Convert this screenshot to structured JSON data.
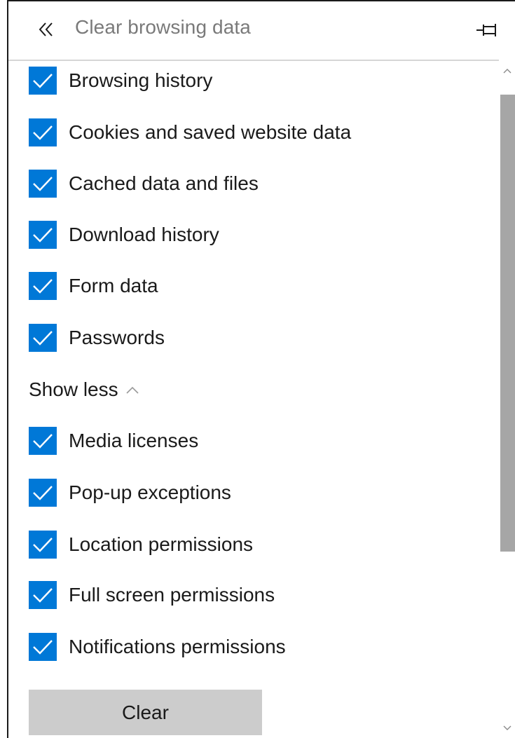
{
  "header": {
    "title": "Clear browsing data",
    "back_icon": "double-chevron-left-icon",
    "pin_icon": "pin-icon"
  },
  "checkboxes": [
    {
      "label": "Browsing history",
      "checked": true
    },
    {
      "label": "Cookies and saved website data",
      "checked": true
    },
    {
      "label": "Cached data and files",
      "checked": true
    },
    {
      "label": "Download history",
      "checked": true
    },
    {
      "label": "Form data",
      "checked": true
    },
    {
      "label": "Passwords",
      "checked": true
    }
  ],
  "show_less": {
    "label": "Show less",
    "icon": "chevron-up-icon"
  },
  "more_checkboxes": [
    {
      "label": "Media licenses",
      "checked": true
    },
    {
      "label": "Pop-up exceptions",
      "checked": true
    },
    {
      "label": "Location permissions",
      "checked": true
    },
    {
      "label": "Full screen permissions",
      "checked": true
    },
    {
      "label": "Notifications permissions",
      "checked": true
    }
  ],
  "clear_button": {
    "label": "Clear"
  },
  "colors": {
    "accent": "#0078d7",
    "button_bg": "#cccccc",
    "scroll_thumb": "#a6a6a6",
    "title_text": "#7a7a7a"
  }
}
